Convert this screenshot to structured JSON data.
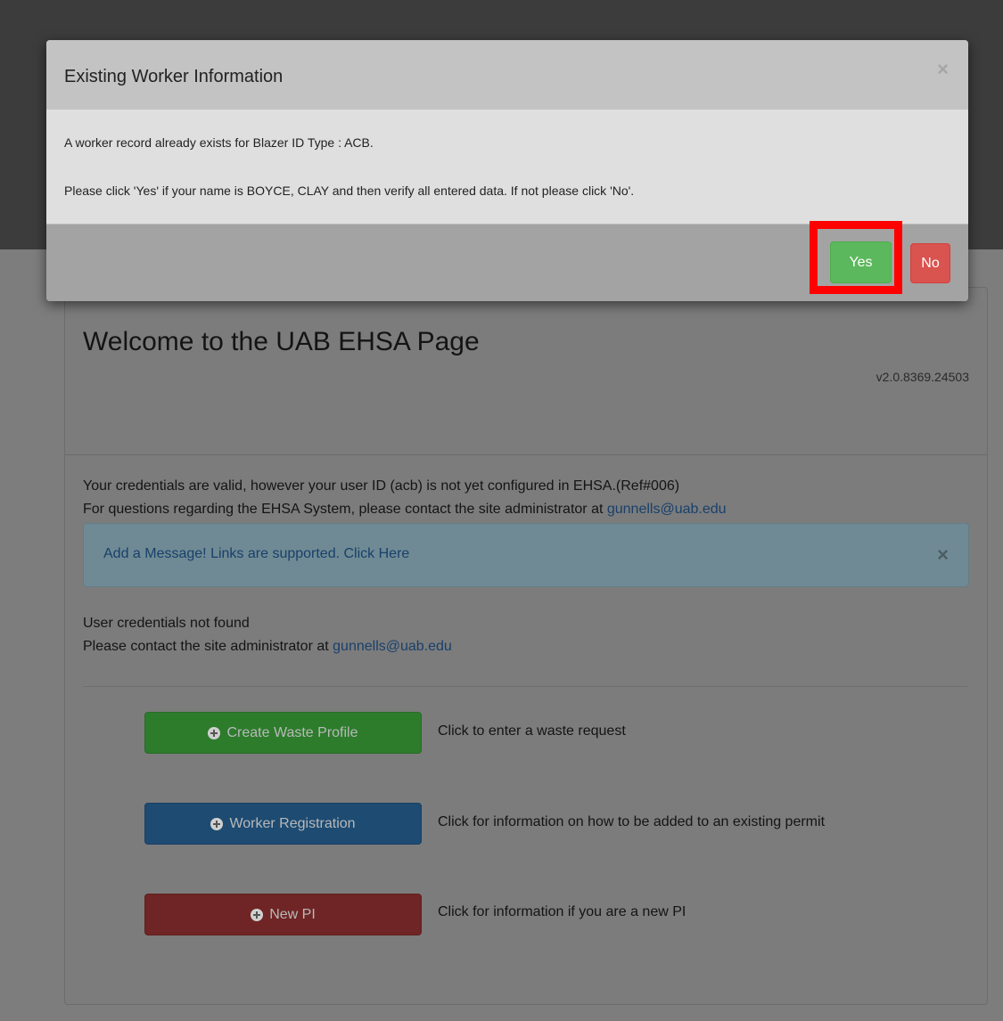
{
  "modal": {
    "title": "Existing Worker Information",
    "close": "×",
    "line1": "A worker record already exists for Blazer ID Type : ACB.",
    "line2": "Please click 'Yes' if your name is BOYCE, CLAY and then verify all entered data. If not please click 'No'.",
    "yes_label": "Yes",
    "no_label": "No"
  },
  "page": {
    "title": "Welcome to the UAB EHSA Page",
    "version": "v2.0.8369.24503",
    "cred_line1": "Your credentials are valid, however your user ID (acb) is not yet configured in EHSA.(Ref#006)",
    "cred_line2_prefix": "For questions regarding the EHSA System, please contact the site administrator at ",
    "admin_email": "gunnells@uab.edu",
    "alert_prefix": "Add a Message! Links are supported. ",
    "alert_link": "Click Here",
    "alert_close": "×",
    "notfound_line1": "User credentials not found",
    "notfound_line2_prefix": "Please contact the site administrator at ",
    "notfound_email": "gunnells@uab.edu"
  },
  "actions": [
    {
      "label": "Create Waste Profile",
      "desc": "Click to enter a waste request",
      "color": "#2c7c2c"
    },
    {
      "label": "Worker Registration",
      "desc": "Click for information on how to be added to an existing permit",
      "color": "#1d4b72"
    },
    {
      "label": "New PI",
      "desc": "Click for information if you are a new PI",
      "color": "#6f2525"
    }
  ],
  "colors": {
    "yes": "#5cb85c",
    "no": "#d9534f",
    "highlight": "#ff0000"
  }
}
